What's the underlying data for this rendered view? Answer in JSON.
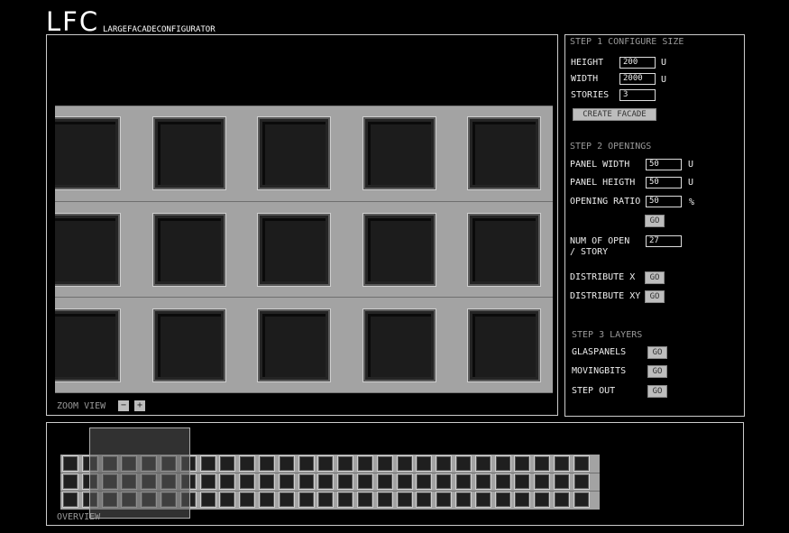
{
  "logo": {
    "title": "LFC",
    "subtitle": "LARGEFACADECONFIGURATOR"
  },
  "main_view": {
    "zoom_label": "ZOOM VIEW",
    "zoom_out": "−",
    "zoom_in": "+"
  },
  "step1": {
    "title": "STEP 1 CONFIGURE SIZE",
    "height_label": "HEIGHT",
    "height_value": "200",
    "height_unit": "U",
    "width_label": "WIDTH",
    "width_value": "2000",
    "width_unit": "U",
    "stories_label": "STORIES",
    "stories_value": "3",
    "create_button": "CREATE FACADE"
  },
  "step2": {
    "title": "STEP 2  OPENINGS",
    "panel_width_label": "PANEL WIDTH",
    "panel_width_value": "50",
    "panel_width_unit": "U",
    "panel_height_label": "PANEL HEIGTH",
    "panel_height_value": "50",
    "panel_height_unit": "U",
    "opening_ratio_label": "OPENING RATIO",
    "opening_ratio_value": "50",
    "opening_ratio_unit": "%",
    "go_button": "GO",
    "num_open_label_1": "NUM OF OPEN",
    "num_open_label_2": "/ STORY",
    "num_open_value": "27",
    "distribute_x_label": "DISTRIBUTE  X",
    "distribute_x_button": "GO",
    "distribute_xy_label": "DISTRIBUTE XY",
    "distribute_xy_button": "GO"
  },
  "step3": {
    "title": "STEP 3  LAYERS",
    "glaspanels_label": "GLASPANELS",
    "glaspanels_button": "GO",
    "movingbits_label": "MOVINGBITS",
    "movingbits_button": "GO",
    "stepout_label": "STEP OUT",
    "stepout_button": "GO"
  },
  "overview": {
    "label": "OVERVIEW",
    "stories": 3,
    "openings_per_story": 27
  },
  "zoom_view_grid": {
    "rows": 3,
    "cols": 5
  }
}
